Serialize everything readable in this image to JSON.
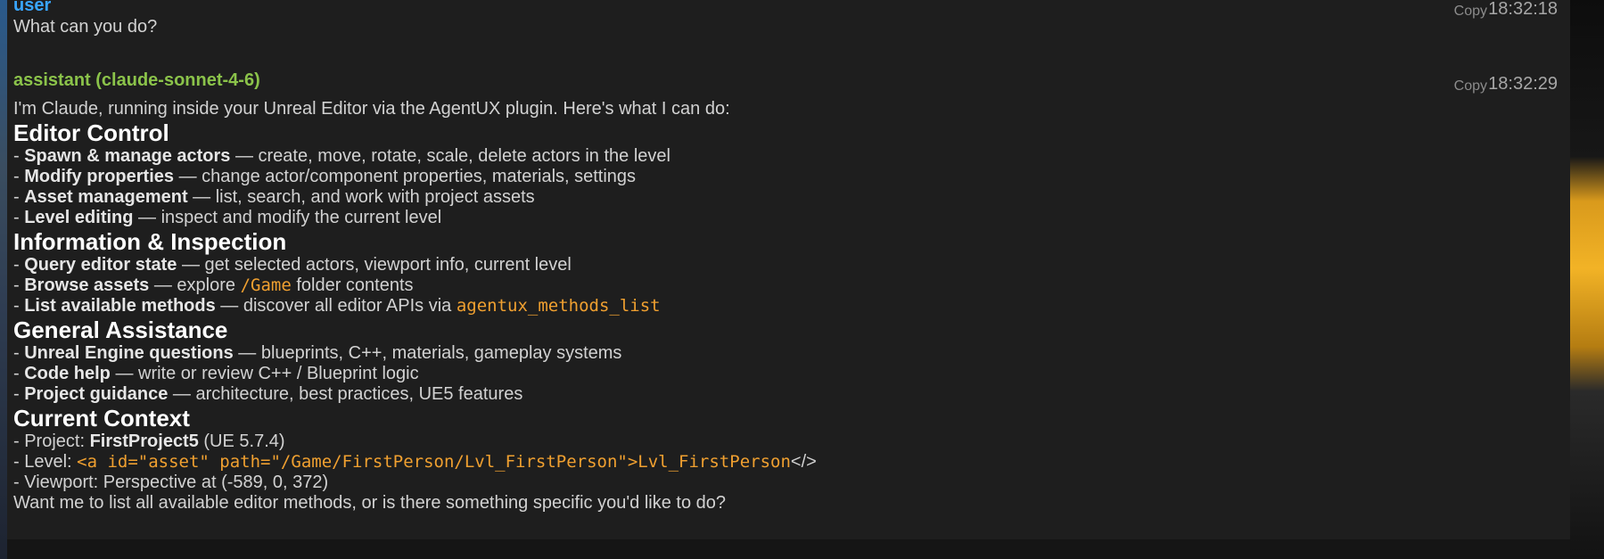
{
  "messages": {
    "user": {
      "sender": "user",
      "copy_label": "Copy",
      "time": "18:32:18",
      "text": "What can you do?"
    },
    "assistant": {
      "sender": "assistant (claude-sonnet-4-6)",
      "copy_label": "Copy",
      "time": "18:32:29",
      "intro": "I'm Claude, running inside your Unreal Editor via the AgentUX plugin. Here's what I can do:",
      "sections": {
        "editor_control": {
          "heading": "Editor Control",
          "items": [
            {
              "label": "Spawn & manage actors",
              "desc": " — create, move, rotate, scale, delete actors in the level"
            },
            {
              "label": "Modify properties",
              "desc": " — change actor/component properties, materials, settings"
            },
            {
              "label": "Asset management",
              "desc": " — list, search, and work with project assets"
            },
            {
              "label": "Level editing",
              "desc": " — inspect and modify the current level"
            }
          ]
        },
        "info": {
          "heading": "Information & Inspection",
          "items": [
            {
              "label": "Query editor state",
              "desc": " — get selected actors, viewport info, current level"
            },
            {
              "label": "Browse assets",
              "desc_pre": " — explore ",
              "code": "/Game",
              "desc_post": " folder contents"
            },
            {
              "label": "List available methods",
              "desc_pre": " — discover all editor APIs via ",
              "code": "agentux_methods_list"
            }
          ]
        },
        "general": {
          "heading": "General Assistance",
          "items": [
            {
              "label": "Unreal Engine questions",
              "desc": " — blueprints, C++, materials, gameplay systems"
            },
            {
              "label": "Code help",
              "desc": " — write or review C++ / Blueprint logic"
            },
            {
              "label": "Project guidance",
              "desc": " — architecture, best practices, UE5 features"
            }
          ]
        },
        "context": {
          "heading": "Current Context",
          "project_prefix": "- Project: ",
          "project_name": "FirstProject5",
          "project_version": " (UE 5.7.4)",
          "level_prefix": "- Level: ",
          "level_code": "<a id=\"asset\" path=\"/Game/FirstPerson/Lvl_FirstPerson\">Lvl_FirstPerson",
          "level_suffix": "</>",
          "viewport": "- Viewport: Perspective at (-589, 0, 372)"
        }
      },
      "closing": "Want me to list all available editor methods, or is there something specific you'd like to do?"
    }
  }
}
